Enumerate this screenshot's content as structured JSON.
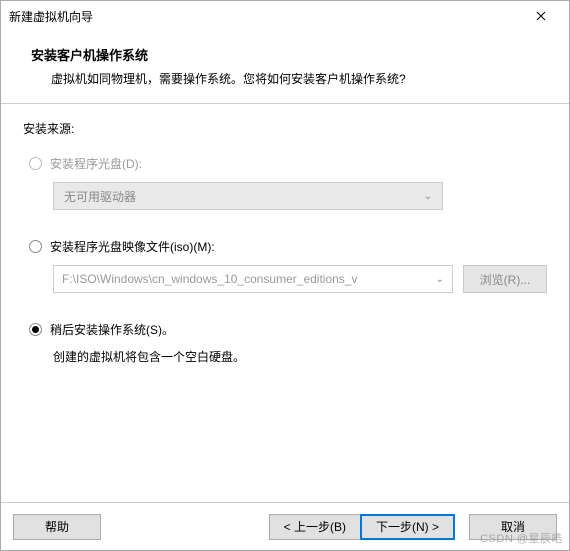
{
  "titlebar": {
    "title": "新建虚拟机向导"
  },
  "header": {
    "title": "安装客户机操作系统",
    "subtitle": "虚拟机如同物理机，需要操作系统。您将如何安装客户机操作系统?"
  },
  "content": {
    "source_label": "安装来源:",
    "opt_disc": {
      "label": "安装程序光盘(D):",
      "dropdown_text": "无可用驱动器"
    },
    "opt_iso": {
      "label": "安装程序光盘映像文件(iso)(M):",
      "path": "F:\\ISO\\Windows\\cn_windows_10_consumer_editions_v",
      "browse": "浏览(R)..."
    },
    "opt_later": {
      "label": "稍后安装操作系统(S)。",
      "desc": "创建的虚拟机将包含一个空白硬盘。"
    }
  },
  "footer": {
    "help": "帮助",
    "back": "< 上一步(B)",
    "next": "下一步(N) >",
    "cancel": "取消"
  },
  "watermark": "CSDN @星辰皓"
}
